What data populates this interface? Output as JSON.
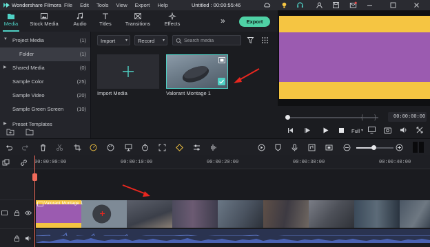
{
  "titlebar": {
    "app_name": "Wondershare Filmora",
    "menu": [
      "File",
      "Edit",
      "Tools",
      "View",
      "Export",
      "Help"
    ],
    "doc_title": "Untitled : 00:00:55:46"
  },
  "tabs": [
    {
      "label": "Media",
      "icon": "media-folder-icon",
      "active": true
    },
    {
      "label": "Stock Media",
      "icon": "stock-media-icon"
    },
    {
      "label": "Audio",
      "icon": "music-note-icon"
    },
    {
      "label": "Titles",
      "icon": "text-T-icon"
    },
    {
      "label": "Transitions",
      "icon": "transitions-icon"
    },
    {
      "label": "Effects",
      "icon": "effects-sparkle-icon"
    }
  ],
  "export_label": "Export",
  "accent_color": "#4fd1c5",
  "sidebar": {
    "items": [
      {
        "label": "Project Media",
        "count": "(1)",
        "caret": "▼"
      },
      {
        "label": "Folder",
        "count": "(1)",
        "selected": true
      },
      {
        "label": "Shared Media",
        "count": "(0)",
        "caret": "▶"
      },
      {
        "label": "Sample Color",
        "count": "(25)"
      },
      {
        "label": "Sample Video",
        "count": "(20)"
      },
      {
        "label": "Sample Green Screen",
        "count": "(10)"
      },
      {
        "label": "Preset Templates",
        "count": "",
        "caret": "▶"
      }
    ]
  },
  "media_toolbar": {
    "import_label": "Import",
    "record_label": "Record",
    "search_placeholder": "Search media"
  },
  "media_items": [
    {
      "label": "Import Media"
    },
    {
      "label": "Valorant Montage 1"
    }
  ],
  "preview": {
    "timecode": "00:00:00:00",
    "quality": "Full",
    "colors": {
      "bar": "#f5c542",
      "center": "#9b5bb0"
    }
  },
  "ruler": {
    "labels": [
      "00:00:00:00",
      "00:00:10:00",
      "00:00:20:00",
      "00:00:30:00",
      "00:00:40:00"
    ]
  },
  "clip": {
    "label": "Valorant Montage 1"
  }
}
